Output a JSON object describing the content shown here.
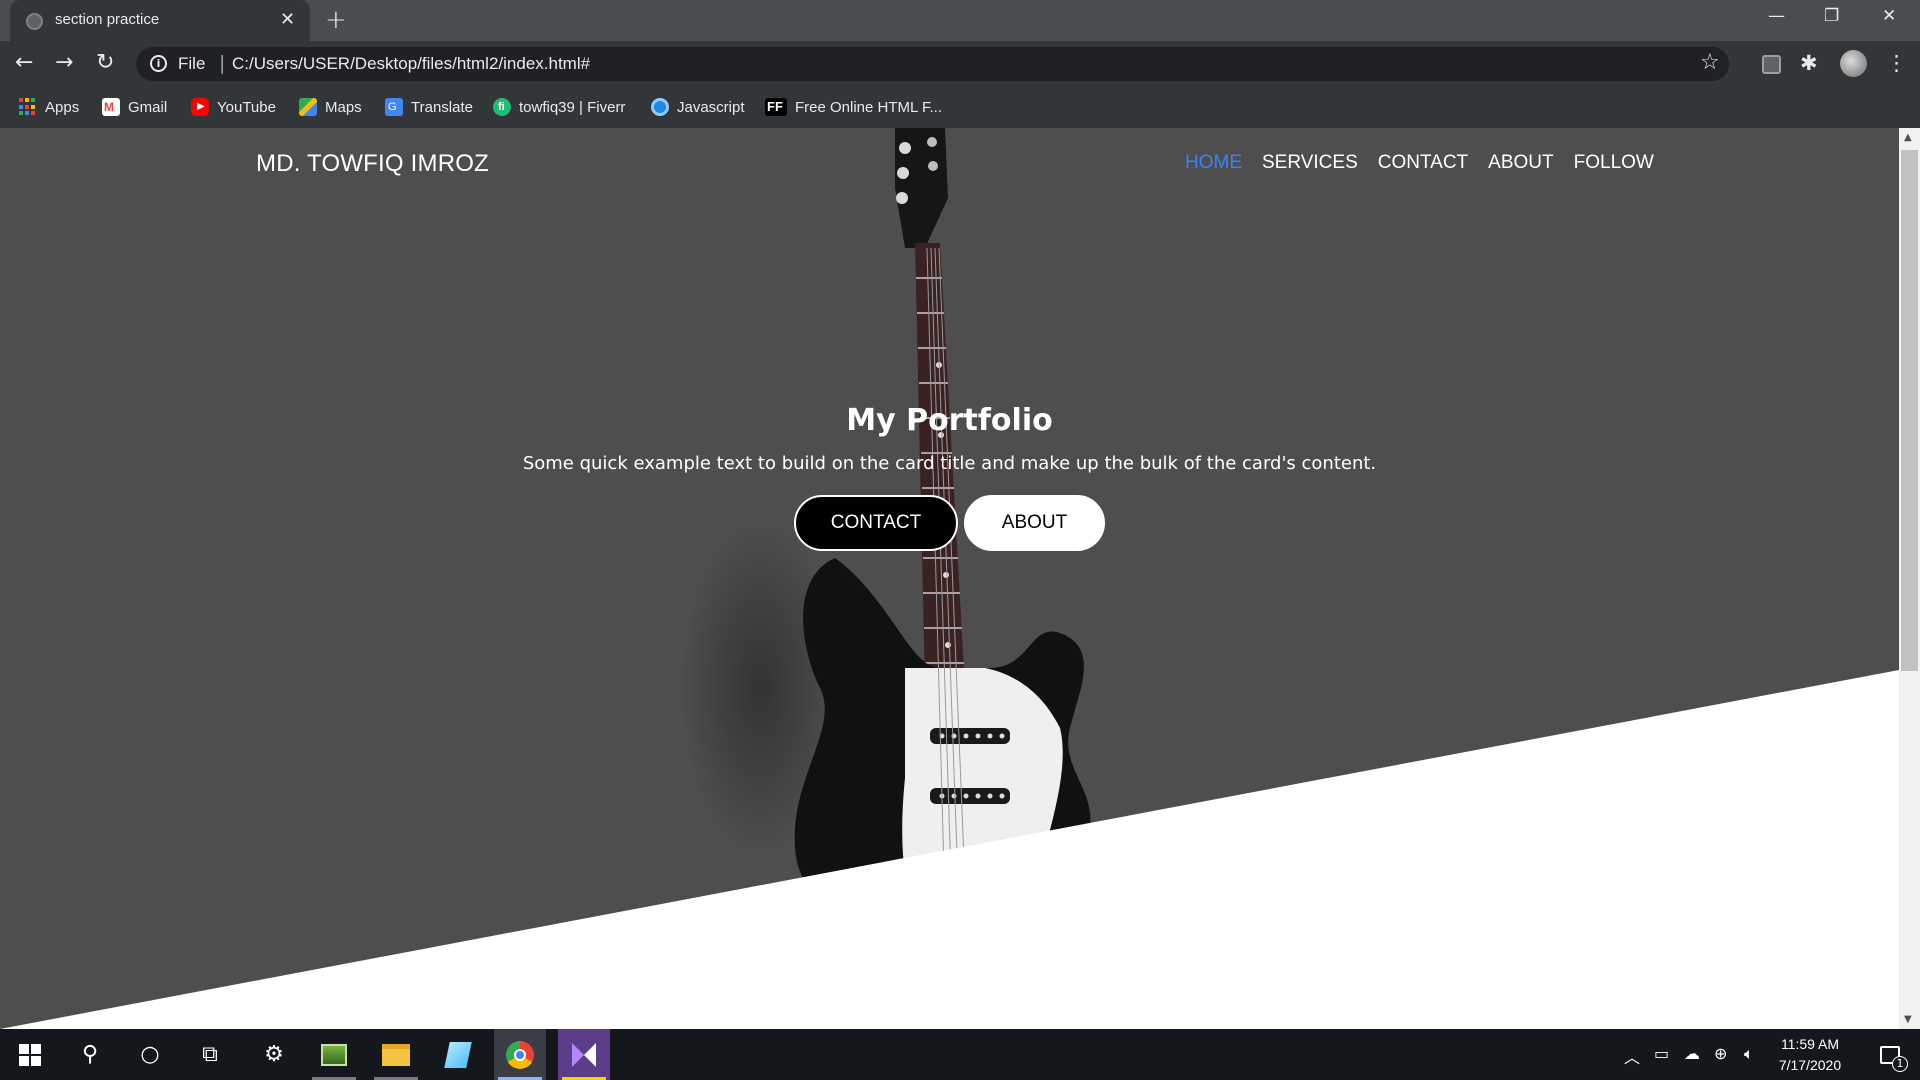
{
  "browser": {
    "tab_title": "section practice",
    "tab_close": "✕",
    "new_tab": "+",
    "window_controls": {
      "minimize": "—",
      "restore": "❐",
      "close": "✕"
    },
    "address": {
      "scheme": "File",
      "url": "C:/Users/USER/Desktop/files/html2/index.html#"
    },
    "bookmarks": [
      {
        "label": "Apps",
        "icon": "apps-grid-icon",
        "color": "#4285f4"
      },
      {
        "label": "Gmail",
        "icon": "gmail-icon",
        "color": "#ea4335"
      },
      {
        "label": "YouTube",
        "icon": "youtube-icon",
        "color": "#ff0000"
      },
      {
        "label": "Maps",
        "icon": "maps-icon",
        "color": "#34a853"
      },
      {
        "label": "Translate",
        "icon": "translate-icon",
        "color": "#4285f4"
      },
      {
        "label": "towfiq39 | Fiverr",
        "icon": "fiverr-icon",
        "color": "#1dbf73"
      },
      {
        "label": "Javascript",
        "icon": "javascript-icon",
        "color": "#1e88e5"
      },
      {
        "label": "Free Online HTML F...",
        "icon": "ff-icon",
        "color": "#000000"
      }
    ]
  },
  "site": {
    "brand": "MD. TOWFIQ IMROZ",
    "nav": [
      {
        "label": "HOME",
        "active": true
      },
      {
        "label": "SERVICES",
        "active": false
      },
      {
        "label": "CONTACT",
        "active": false
      },
      {
        "label": "ABOUT",
        "active": false
      },
      {
        "label": "FOLLOW",
        "active": false
      }
    ],
    "accent_color": "#3b82f6",
    "hero": {
      "title": "My Portfolio",
      "text": "Some quick example text to build on the card title and make up the bulk of the card's content.",
      "contact_button": "CONTACT",
      "about_button": "ABOUT"
    }
  },
  "taskbar": {
    "time": "11:59 AM",
    "date": "7/17/2020",
    "notification_count": "1"
  }
}
